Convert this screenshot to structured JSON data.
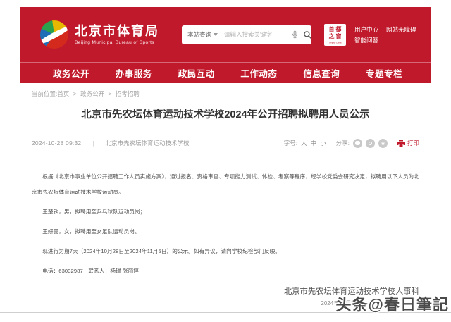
{
  "header": {
    "agency_name": "北京市体育局",
    "agency_name_en": "Beijing Municipal Bureau of Sports",
    "search_scope": "本站查询",
    "search_placeholder": "请输入搜索关键字",
    "seal_char1": "首",
    "seal_char2": "都",
    "seal_char3": "之",
    "seal_char4": "窗",
    "seal_caption": "Beijing·China",
    "link_user_center": "用户中心",
    "link_accessibility": "网站无障碍",
    "link_smart_qa": "智能问答"
  },
  "nav": {
    "items": [
      "政务公开",
      "办事服务",
      "政民互动",
      "工作动态",
      "信息查询",
      "专题专栏"
    ]
  },
  "breadcrumb": {
    "label": "当前位置:",
    "home": "首页",
    "sep": ">",
    "level1": "政务公开",
    "level2": "招考招聘"
  },
  "article": {
    "title": "北京市先农坛体育运动技术学校2024年公开招聘拟聘用人员公示",
    "publish_time": "2024-10-28 09:32",
    "pipe": "|",
    "source": "北京市先农坛体育运动技术学校",
    "font_size_label": "字号:",
    "font_large": "大",
    "font_medium": "中",
    "font_small": "小",
    "share_label": "分享:",
    "print_label": "打印",
    "paragraphs": [
      "根据《北京市事业单位公开招聘工作人员实施方案》，通过报名、资格审查、专项能力测试、体检、考察等程序，经学校党委会研究决定，拟聘用以下人员为北京市先农坛体育运动技术学校运动员。",
      "王楚钦，男，拟聘用至乒乓球队运动员岗；",
      "王妍雯，女，拟聘用至女足队运动员岗。",
      "现进行为期7天（2024年10月28日至2024年11月5日）的公示。如有异议，请向学校纪检部门反映。",
      "电话：63032987　联系人：杨瑞 张丽婷"
    ],
    "signature": "北京市先农坛体育运动技术学校人事科",
    "sign_date": "2024年10月27日"
  },
  "watermark": "头条@春日筆記",
  "icons": {
    "star_glyph": "★"
  },
  "colors": {
    "primary_red": "#c0192b",
    "print_red": "#c0192b",
    "body_text": "#4d4d4d",
    "meta_gray": "#999999"
  }
}
